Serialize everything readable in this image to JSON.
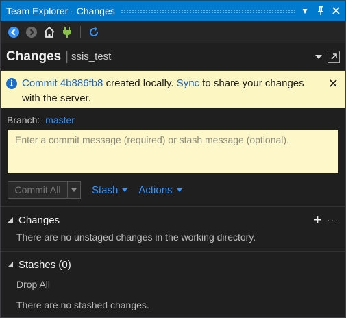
{
  "window": {
    "title": "Team Explorer - Changes",
    "title_icons": [
      "dropdown-icon",
      "pin-icon",
      "close-icon"
    ]
  },
  "toolbar": {
    "icons": [
      "back-icon",
      "forward-icon",
      "home-icon",
      "connect-icon",
      "refresh-icon"
    ]
  },
  "header": {
    "title": "Changes",
    "separator": "|",
    "repo": "ssis_test"
  },
  "info_bar": {
    "commit_link": "Commit 4b886fb8",
    "text_mid": " created locally. ",
    "sync_link": "Sync",
    "text_end": " to share your changes with the server.",
    "close": "✕"
  },
  "branch": {
    "label": "Branch:",
    "name": "master"
  },
  "commit_message": {
    "placeholder": "Enter a commit message (required) or stash message (optional)."
  },
  "actions": {
    "commit_all": "Commit All",
    "stash": "Stash",
    "actions": "Actions"
  },
  "changes_section": {
    "title": "Changes",
    "empty_text": "There are no unstaged changes in the working directory."
  },
  "stashes_section": {
    "title": "Stashes (0)",
    "drop_all": "Drop All",
    "empty_text": "There are no stashed changes."
  },
  "colors": {
    "accent": "#007acc",
    "link": "#3794ff",
    "info_background": "#fcf6c3",
    "commit_box_background": "#fdf7c9"
  }
}
